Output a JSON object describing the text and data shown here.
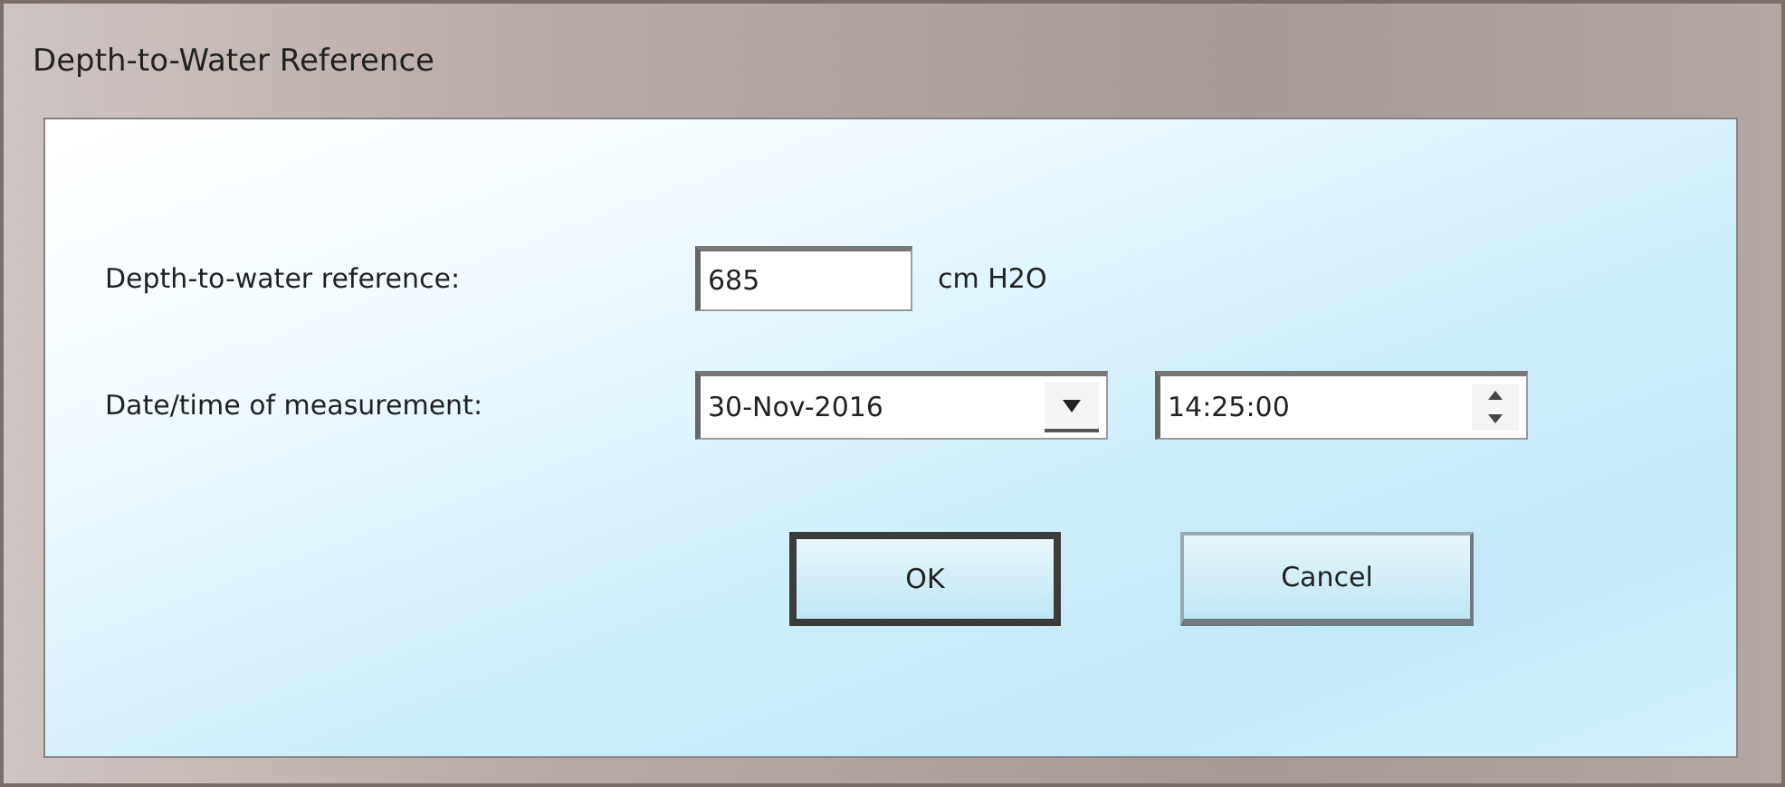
{
  "window": {
    "title": "Depth-to-Water Reference"
  },
  "reference": {
    "label": "Depth-to-water reference:",
    "value": "685",
    "unit": "cm H2O"
  },
  "measurement": {
    "label": "Date/time of measurement:",
    "date": "30-Nov-2016",
    "time": "14:25:00"
  },
  "buttons": [
    {
      "label": "OK",
      "default": true
    },
    {
      "label": "Cancel",
      "default": false
    }
  ]
}
